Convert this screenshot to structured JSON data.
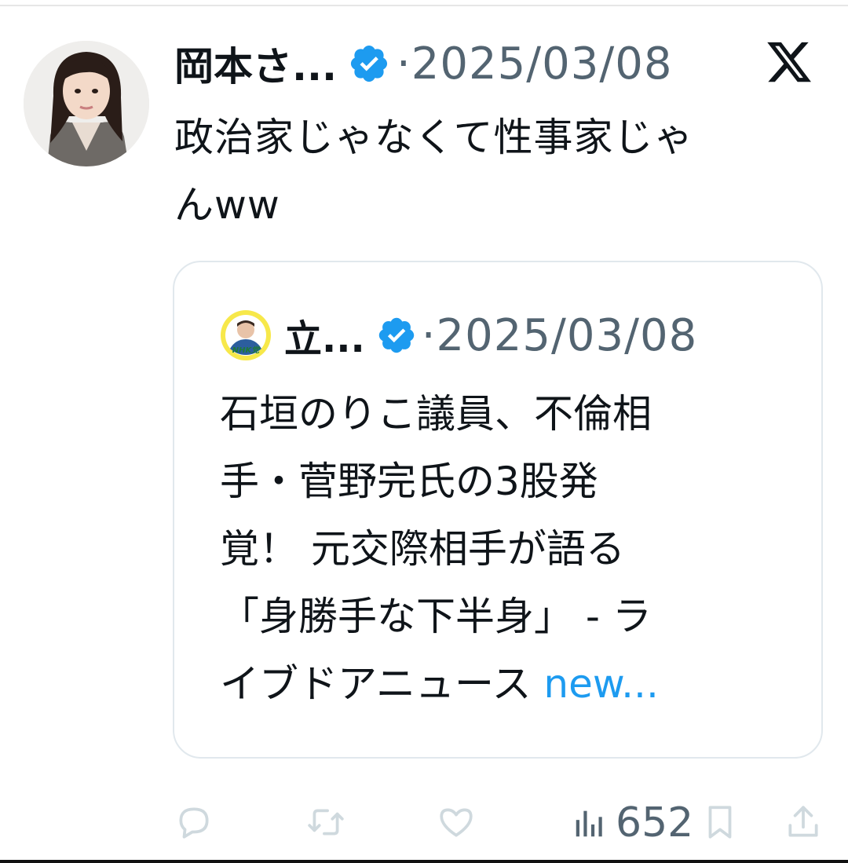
{
  "tweet": {
    "author_name": "岡本さ...",
    "date": "·2025/03/08",
    "body_lines": [
      "政治家じゃなくて性事家じゃ",
      "んww"
    ]
  },
  "quote": {
    "author_name": "立...",
    "avatar_badge": "NHK党",
    "date": "·2025/03/08",
    "lines": [
      "石垣のりこ議員、不倫相",
      "手・菅野完氏の3股発",
      "覚！ 元交際相手が語る",
      "「身勝手な下半身」 - ラ",
      "イブドアニュース "
    ],
    "link_text": "new..."
  },
  "actions": {
    "views_count": "652"
  },
  "colors": {
    "verified": "#1d9bf0",
    "muted": "#536471",
    "link": "#1d9bf0",
    "action_icon": "#cfd9de"
  }
}
